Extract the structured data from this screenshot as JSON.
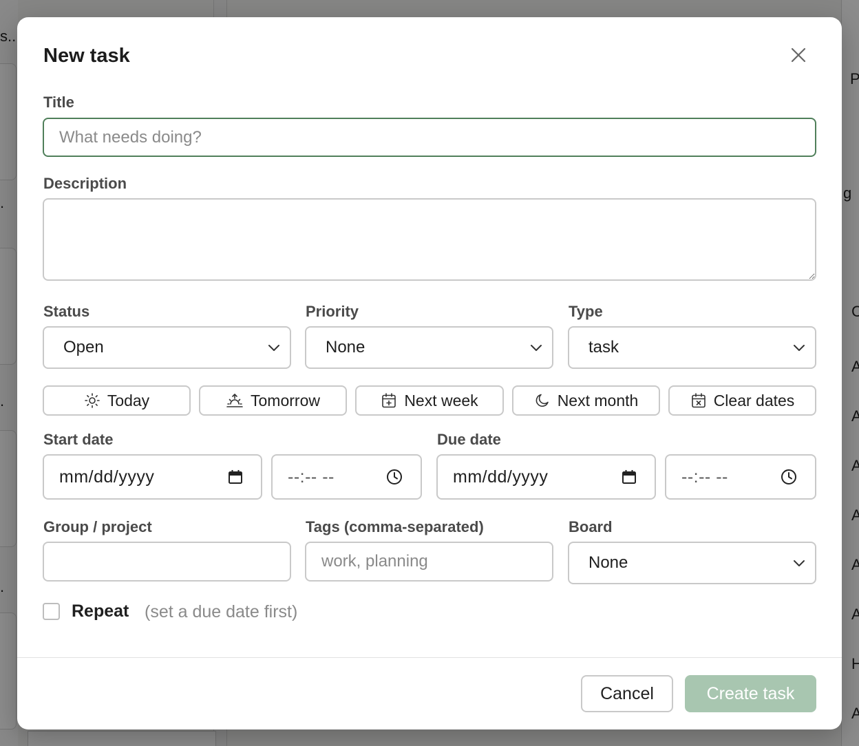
{
  "background": {
    "left_snippets": [
      "s...",
      ".",
      ".",
      "."
    ],
    "right_snippets": [
      "P",
      "g",
      "C",
      "A",
      "A",
      "A",
      "A",
      "A",
      "A",
      "H",
      "A"
    ]
  },
  "modal": {
    "title": "New task",
    "close_icon": "close-icon",
    "title_field": {
      "label": "Title",
      "placeholder": "What needs doing?",
      "value": ""
    },
    "description_field": {
      "label": "Description",
      "value": ""
    },
    "status": {
      "label": "Status",
      "value": "Open"
    },
    "priority": {
      "label": "Priority",
      "value": "None"
    },
    "type": {
      "label": "Type",
      "value": "task"
    },
    "quick_dates": [
      {
        "label": "Today",
        "icon": "sun-icon"
      },
      {
        "label": "Tomorrow",
        "icon": "sunrise-icon"
      },
      {
        "label": "Next week",
        "icon": "calendar-plus-icon"
      },
      {
        "label": "Next month",
        "icon": "moon-icon"
      },
      {
        "label": "Clear dates",
        "icon": "calendar-x-icon"
      }
    ],
    "start_date": {
      "label": "Start date",
      "date_placeholder": "mm/dd/yyyy",
      "time_placeholder": "--:-- --"
    },
    "due_date": {
      "label": "Due date",
      "date_placeholder": "mm/dd/yyyy",
      "time_placeholder": "--:-- --"
    },
    "group": {
      "label": "Group / project",
      "value": ""
    },
    "tags": {
      "label": "Tags (comma-separated)",
      "placeholder": "work, planning",
      "value": ""
    },
    "board": {
      "label": "Board",
      "value": "None"
    },
    "repeat": {
      "label": "Repeat",
      "hint": "(set a due date first)",
      "checked": false
    },
    "footer": {
      "cancel_label": "Cancel",
      "create_label": "Create task"
    }
  },
  "colors": {
    "focus_border": "#4f7f5a",
    "create_button_disabled": "#a8c6b0",
    "overlay": "rgba(0,0,0,0.45)"
  }
}
